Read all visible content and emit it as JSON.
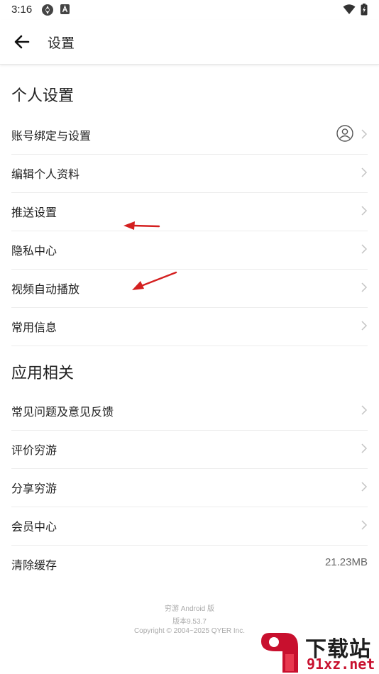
{
  "status_bar": {
    "time": "3:16"
  },
  "header": {
    "title": "设置"
  },
  "personal_section": {
    "title": "个人设置",
    "items": [
      {
        "label": "账号绑定与设置"
      },
      {
        "label": "编辑个人资料"
      },
      {
        "label": "推送设置"
      },
      {
        "label": "隐私中心"
      },
      {
        "label": "视频自动播放"
      },
      {
        "label": "常用信息"
      }
    ]
  },
  "app_section": {
    "title": "应用相关",
    "items": [
      {
        "label": "常见问题及意见反馈"
      },
      {
        "label": "评价穷游"
      },
      {
        "label": "分享穷游"
      },
      {
        "label": "会员中心"
      },
      {
        "label": "清除缓存",
        "value": "21.23MB"
      }
    ]
  },
  "footer": {
    "app_name": "穷游 Android 版",
    "version": "版本9.53.7",
    "copyright": "Copyright © 2004~2025 QYER Inc."
  },
  "watermark": {
    "top": "下载站",
    "bottom": "91xz.net"
  },
  "colors": {
    "annotation_arrow": "#d42020",
    "divider": "#ececec",
    "chevron": "#c4c4c4"
  },
  "icons": [
    "back-arrow-icon",
    "chevron-right-icon",
    "avatar-icon",
    "wifi-icon",
    "battery-icon"
  ]
}
